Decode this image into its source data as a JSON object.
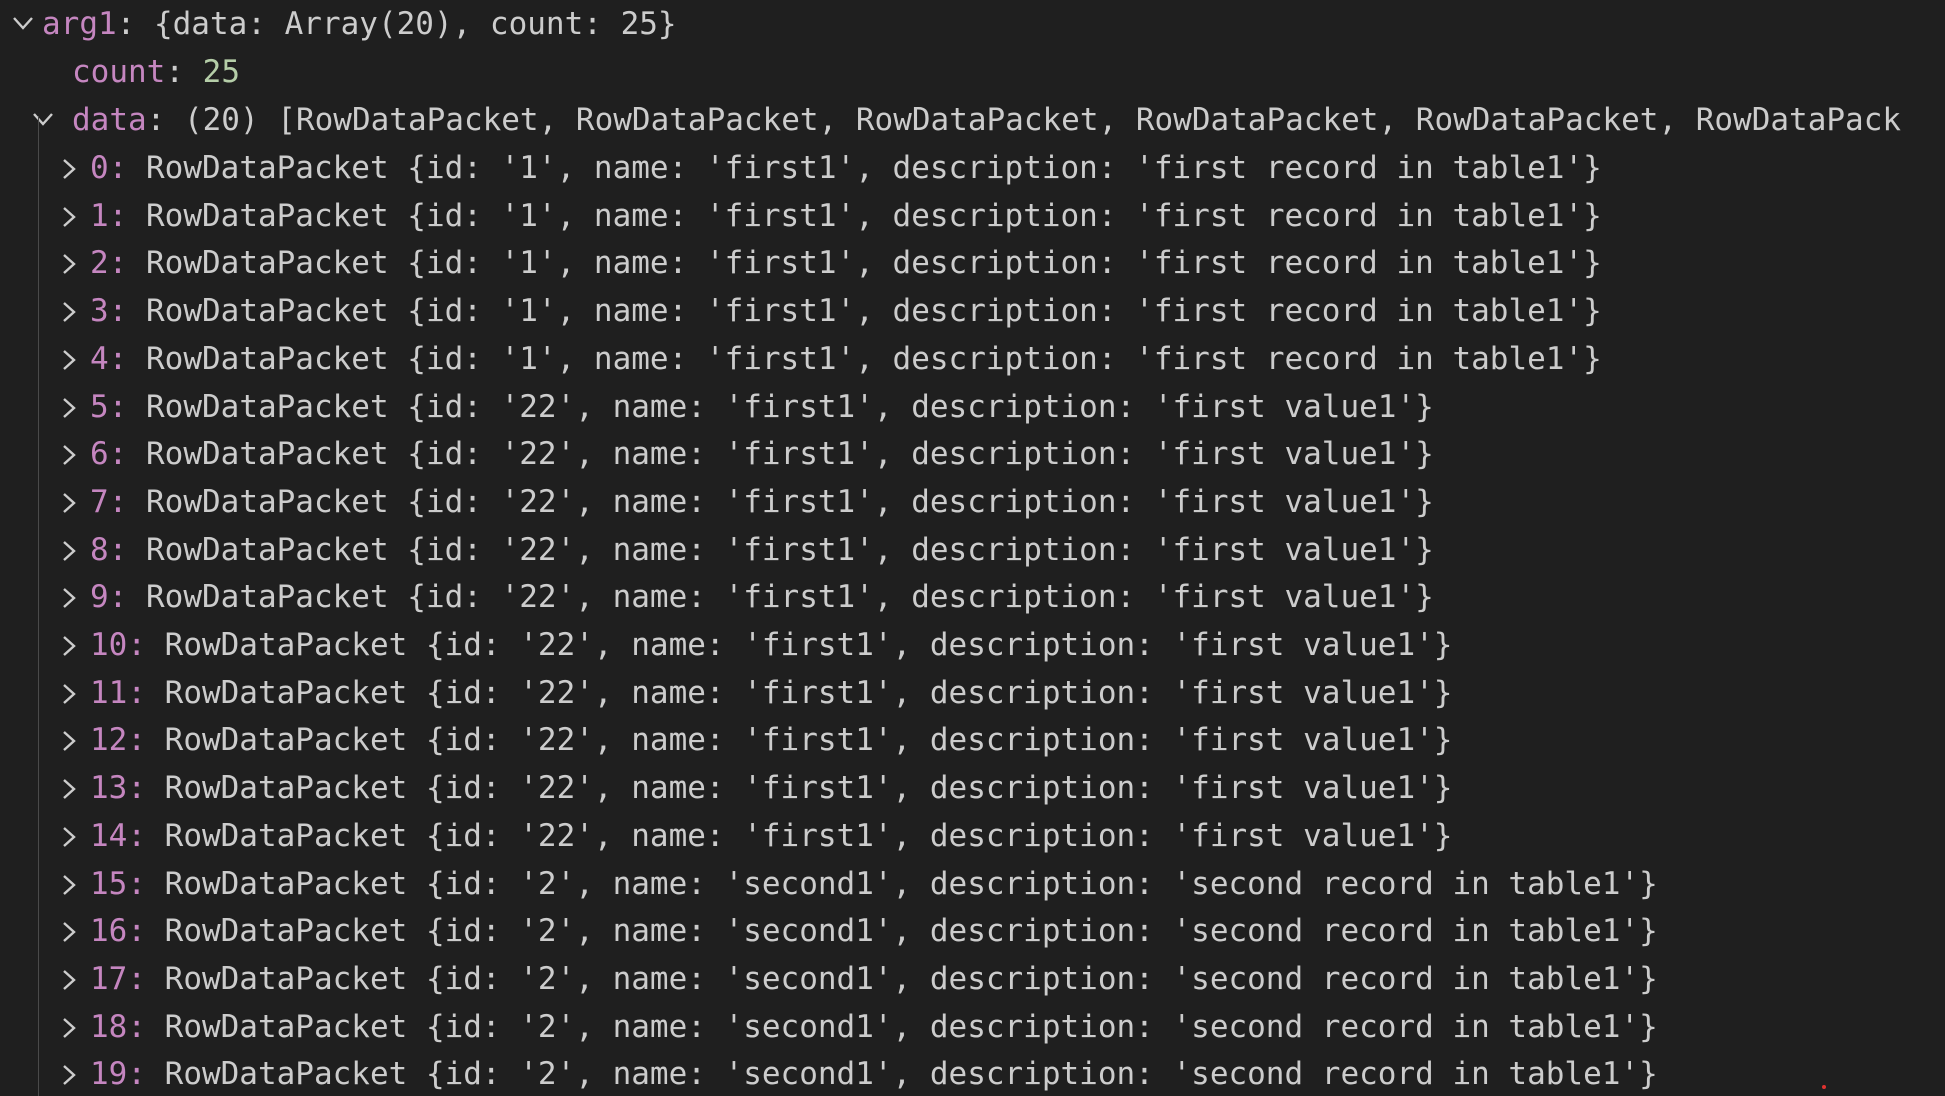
{
  "root": {
    "key": "arg1",
    "summary": "{data: Array(20), count: 25}"
  },
  "count": {
    "key": "count",
    "value": "25"
  },
  "data": {
    "key": "data",
    "summary": "(20) [RowDataPacket, RowDataPacket, RowDataPacket, RowDataPacket, RowDataPacket, RowDataPack"
  },
  "items": [
    {
      "index": "0",
      "text": "RowDataPacket {id: '1', name: 'first1', description: 'first record in table1'}"
    },
    {
      "index": "1",
      "text": "RowDataPacket {id: '1', name: 'first1', description: 'first record in table1'}"
    },
    {
      "index": "2",
      "text": "RowDataPacket {id: '1', name: 'first1', description: 'first record in table1'}"
    },
    {
      "index": "3",
      "text": "RowDataPacket {id: '1', name: 'first1', description: 'first record in table1'}"
    },
    {
      "index": "4",
      "text": "RowDataPacket {id: '1', name: 'first1', description: 'first record in table1'}"
    },
    {
      "index": "5",
      "text": "RowDataPacket {id: '22', name: 'first1', description: 'first value1'}"
    },
    {
      "index": "6",
      "text": "RowDataPacket {id: '22', name: 'first1', description: 'first value1'}"
    },
    {
      "index": "7",
      "text": "RowDataPacket {id: '22', name: 'first1', description: 'first value1'}"
    },
    {
      "index": "8",
      "text": "RowDataPacket {id: '22', name: 'first1', description: 'first value1'}"
    },
    {
      "index": "9",
      "text": "RowDataPacket {id: '22', name: 'first1', description: 'first value1'}"
    },
    {
      "index": "10",
      "text": "RowDataPacket {id: '22', name: 'first1', description: 'first value1'}"
    },
    {
      "index": "11",
      "text": "RowDataPacket {id: '22', name: 'first1', description: 'first value1'}"
    },
    {
      "index": "12",
      "text": "RowDataPacket {id: '22', name: 'first1', description: 'first value1'}"
    },
    {
      "index": "13",
      "text": "RowDataPacket {id: '22', name: 'first1', description: 'first value1'}"
    },
    {
      "index": "14",
      "text": "RowDataPacket {id: '22', name: 'first1', description: 'first value1'}"
    },
    {
      "index": "15",
      "text": "RowDataPacket {id: '2', name: 'second1', description: 'second record in table1'}"
    },
    {
      "index": "16",
      "text": "RowDataPacket {id: '2', name: 'second1', description: 'second record in table1'}"
    },
    {
      "index": "17",
      "text": "RowDataPacket {id: '2', name: 'second1', description: 'second record in table1'}"
    },
    {
      "index": "18",
      "text": "RowDataPacket {id: '2', name: 'second1', description: 'second record in table1'}"
    },
    {
      "index": "19",
      "text": "RowDataPacket {id: '2', name: 'second1', description: 'second record in table1'}"
    }
  ],
  "colors": {
    "background": "#1f1f1f",
    "key": "#c586c0",
    "number": "#b5cea8",
    "text": "#cccccc",
    "guide": "#4a4a4a",
    "marker": "#e0322f"
  },
  "icons": {
    "expanded": "chevron-down-icon",
    "collapsed": "chevron-right-icon"
  }
}
